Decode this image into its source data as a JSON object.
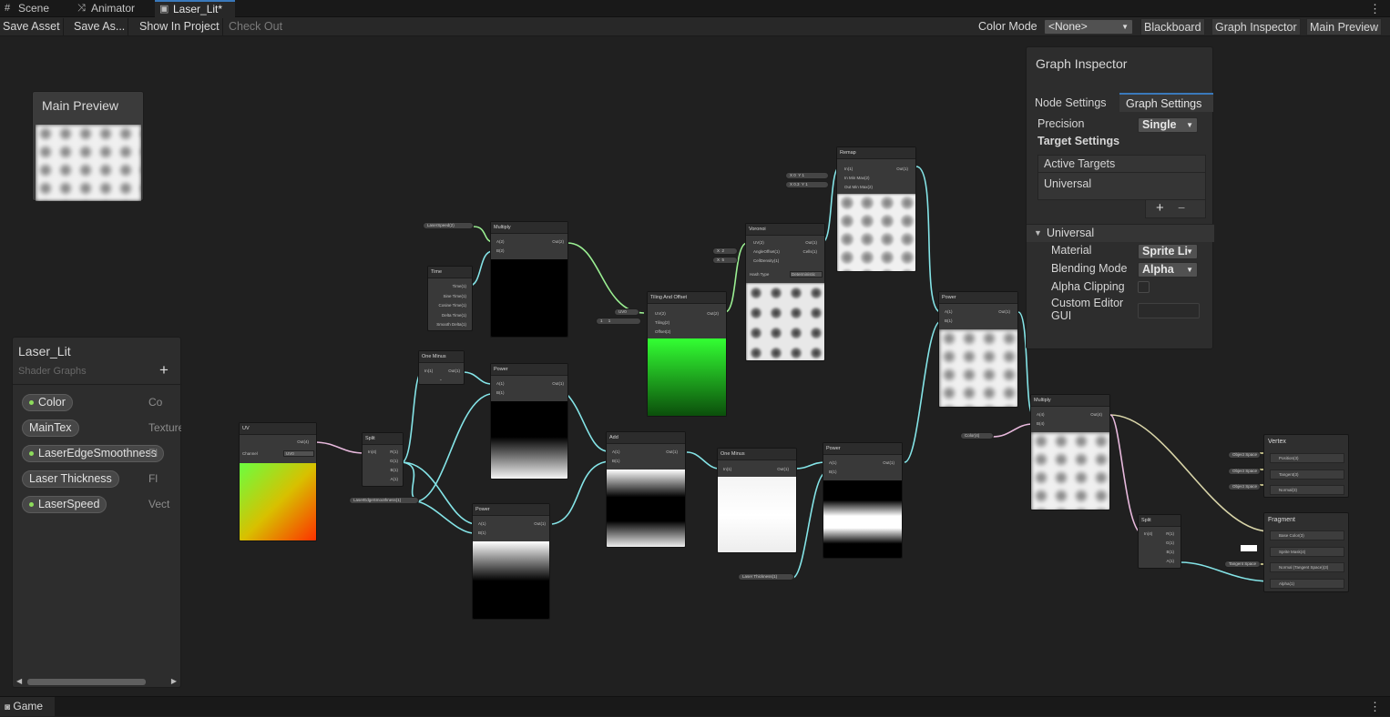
{
  "tabs": [
    {
      "label": "Scene",
      "icon": "hash-icon"
    },
    {
      "label": "Animator",
      "icon": "animator-icon"
    },
    {
      "label": "Laser_Lit*",
      "icon": "shadergraph-icon"
    }
  ],
  "toolbar": {
    "save_asset": "Save Asset",
    "save_as": "Save As...",
    "show_in_project": "Show In Project",
    "check_out": "Check Out",
    "color_mode_label": "Color Mode",
    "color_mode_value": "<None>",
    "blackboard": "Blackboard",
    "graph_inspector": "Graph Inspector",
    "main_preview": "Main Preview"
  },
  "main_preview": {
    "title": "Main Preview"
  },
  "blackboard": {
    "title": "Laser_Lit",
    "subtitle": "Shader Graphs",
    "add": "+",
    "properties": [
      {
        "name": "Color",
        "type": "Co",
        "dot": true
      },
      {
        "name": "MainTex",
        "type": "Texture",
        "dot": false
      },
      {
        "name": "LaserEdgeSmoothness",
        "type": "Fl",
        "dot": true
      },
      {
        "name": "Laser Thickness",
        "type": "Fl",
        "dot": false
      },
      {
        "name": "LaserSpeed",
        "type": "Vect",
        "dot": true
      }
    ]
  },
  "graph_inspector": {
    "title": "Graph Inspector",
    "tab_node": "Node Settings",
    "tab_graph": "Graph Settings",
    "precision_label": "Precision",
    "precision_value": "Single",
    "target_settings": "Target Settings",
    "active_targets": "Active Targets",
    "target_item": "Universal",
    "add_btn": "+",
    "remove_btn": "−",
    "section": "Universal",
    "material_label": "Material",
    "material_value": "Sprite Li",
    "blending_label": "Blending Mode",
    "blending_value": "Alpha",
    "alpha_clip_label": "Alpha Clipping",
    "alpha_clip_checked": false,
    "custom_editor_label": "Custom Editor GUI",
    "custom_editor_value": ""
  },
  "nodes": {
    "uv": {
      "title": "UV",
      "out": "Out(4)",
      "channel_label": "Channel",
      "channel_value": "UV0"
    },
    "split1": {
      "title": "Split",
      "in": "In(4)",
      "outs": [
        "R(1)",
        "G(1)",
        "B(1)",
        "A(1)"
      ]
    },
    "one_minus1": {
      "title": "One Minus",
      "in": "In(1)",
      "out": "Out(1)"
    },
    "multiply1": {
      "title": "Multiply",
      "a": "A(2)",
      "b": "B(2)",
      "out": "Out(2)"
    },
    "time": {
      "title": "Time",
      "outs": [
        "Time(1)",
        "Sine Time(1)",
        "Cosine Time(1)",
        "Delta Time(1)",
        "Smooth Delta(1)"
      ]
    },
    "power1": {
      "title": "Power",
      "a": "A(1)",
      "b": "B(1)",
      "out": "Out(1)"
    },
    "power2": {
      "title": "Power",
      "a": "A(1)",
      "b": "B(1)",
      "out": "Out(1)"
    },
    "tiling": {
      "title": "Tiling And Offset",
      "uv": "UV(2)",
      "tiling": "Tiling(2)",
      "offset": "Offset(2)",
      "out": "Out(2)",
      "uv_value": "UV0",
      "x": "1",
      "y": "1"
    },
    "voronoi": {
      "title": "Voronoi",
      "uv": "UV(2)",
      "angle": "AngleOffset(1)",
      "density": "CellDensity(1)",
      "out": "Out(1)",
      "cells": "Cells(1)",
      "hash_label": "Hash Type",
      "hash_value": "Deterministic",
      "angle_value": "2",
      "density_value": "5"
    },
    "remap": {
      "title": "Remap",
      "in": "In(1)",
      "inminmax": "In Min Max(2)",
      "outminmax": "Out Min Max(2)",
      "out": "Out(1)",
      "in_x": "0",
      "in_y": "1",
      "out_x": "0.3",
      "out_y": "1"
    },
    "add": {
      "title": "Add",
      "a": "A(1)",
      "b": "B(1)",
      "out": "Out(1)"
    },
    "one_minus2": {
      "title": "One Minus",
      "in": "In(1)",
      "out": "Out(1)"
    },
    "power3": {
      "title": "Power",
      "a": "A(1)",
      "b": "B(1)",
      "out": "Out(1)"
    },
    "power4": {
      "title": "Power",
      "a": "A(1)",
      "b": "B(1)",
      "out": "Out(1)"
    },
    "multiply2": {
      "title": "Multiply",
      "a": "A(4)",
      "b": "B(4)",
      "out": "Out(4)"
    },
    "split2": {
      "title": "Split",
      "in": "In(4)",
      "outs": [
        "R(1)",
        "G(1)",
        "B(1)",
        "A(1)"
      ]
    },
    "vertex": {
      "title": "Vertex",
      "ports": [
        "Position(3)",
        "Tangent(3)",
        "Normal(3)"
      ],
      "space": "Object Space"
    },
    "fragment": {
      "title": "Fragment",
      "ports": [
        "Base Color(3)",
        "Sprite Mask(4)",
        "Normal (Tangent Space)(3)",
        "Alpha(1)"
      ],
      "space": "Tangent Space"
    }
  },
  "pills": {
    "laser_speed": "LaserSpeed(2)",
    "edge_smooth": "LaserEdgeSmoothness(1)",
    "thickness": "Laser Thickness(1)",
    "color": "Color(4)"
  },
  "bottom": {
    "game_tab": "Game"
  },
  "colors": {
    "accent": "#3a79bb",
    "wire_float": "#84e4e7",
    "wire_vec2": "#9aef92",
    "wire_vec4": "#fbcbf4",
    "dot_green": "#8ddc5b"
  }
}
